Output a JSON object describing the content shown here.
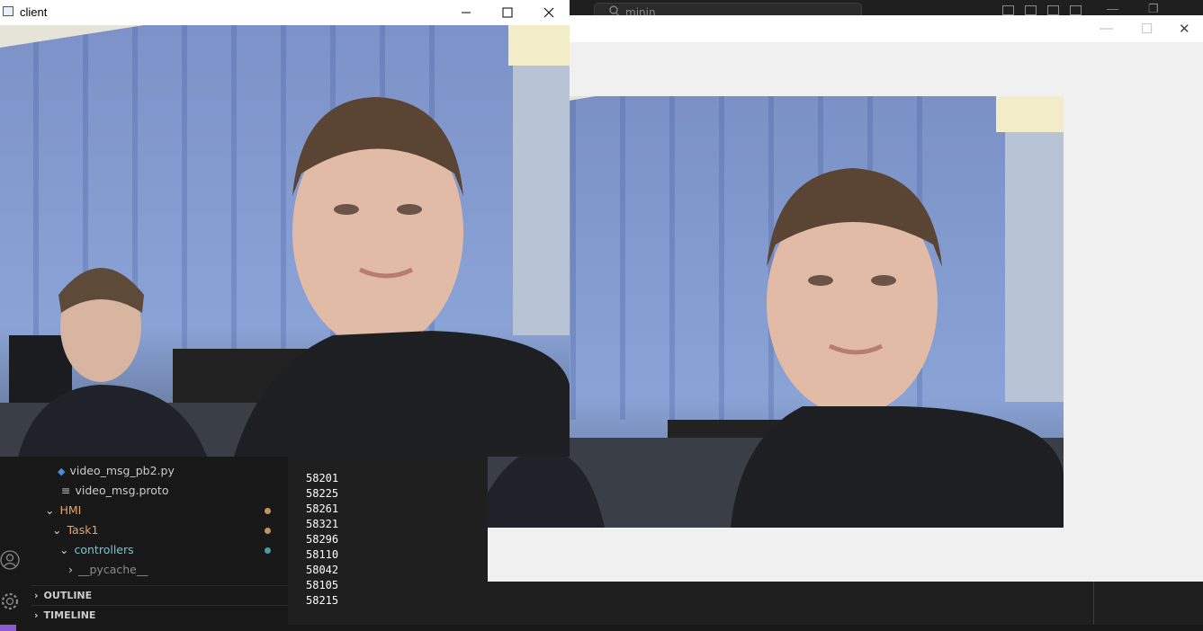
{
  "vscode": {
    "search_placeholder": "minin",
    "explorer": {
      "items": [
        {
          "label": "video_msg_pb2.py",
          "type": "python-file"
        },
        {
          "label": "video_msg.proto",
          "type": "proto-file"
        },
        {
          "label": "HMI",
          "type": "folder",
          "color": "#e8a26a"
        },
        {
          "label": "Task1",
          "type": "folder",
          "color": "#e8a26a"
        },
        {
          "label": "controllers",
          "type": "folder",
          "color": "#73c7d9"
        },
        {
          "label": "__pycache__",
          "type": "folder",
          "color": "#8a8a8a"
        }
      ]
    },
    "sections": {
      "outline": "OUTLINE",
      "timeline": "TIMELINE"
    },
    "terminal_output": [
      "58201",
      "58225",
      "58261",
      "58321",
      "58296",
      "58110",
      "58042",
      "58105",
      "58215"
    ]
  },
  "client_window": {
    "title": "client"
  },
  "colors": {
    "modified_dot": "#c4935a",
    "untracked_dot": "#4c9aa8",
    "accent_purple": "#8a5cd1"
  }
}
